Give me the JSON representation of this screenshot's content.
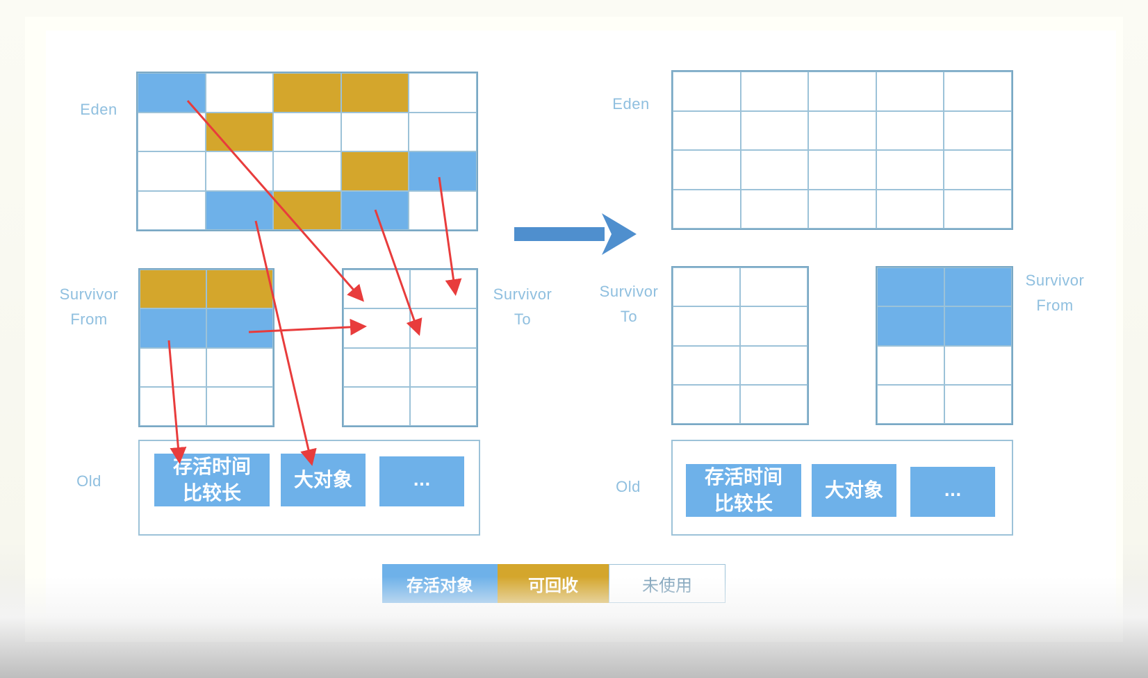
{
  "colors": {
    "live": "#6eb1e9",
    "reclaimable": "#d4a62c",
    "unused": "#ffffff",
    "arrow_red": "#e83c3c",
    "arrow_blue": "#4f8fce",
    "label": "#8fbfdf"
  },
  "before": {
    "eden_label": "Eden",
    "survivor_from_label": [
      "Survivor",
      "From"
    ],
    "survivor_to_label": [
      "Survivor",
      "To"
    ],
    "old_label": "Old",
    "eden_cells": [
      [
        "live",
        "empty",
        "recl",
        "recl",
        "empty"
      ],
      [
        "empty",
        "recl",
        "empty",
        "empty",
        "empty"
      ],
      [
        "empty",
        "empty",
        "empty",
        "recl",
        "live"
      ],
      [
        "empty",
        "live",
        "recl",
        "live",
        "empty"
      ]
    ],
    "from_cells": [
      [
        "recl",
        "recl"
      ],
      [
        "live",
        "live"
      ],
      [
        "empty",
        "empty"
      ],
      [
        "empty",
        "empty"
      ]
    ],
    "to_cells": [
      [
        "empty",
        "empty"
      ],
      [
        "empty",
        "empty"
      ],
      [
        "empty",
        "empty"
      ],
      [
        "empty",
        "empty"
      ]
    ],
    "old_items": [
      "存活时间\n比较长",
      "大对象",
      "..."
    ]
  },
  "after": {
    "eden_label": "Eden",
    "survivor_to_label": [
      "Survivor",
      "To"
    ],
    "survivor_from_label": [
      "Survivor",
      "From"
    ],
    "old_label": "Old",
    "eden_cells": [
      [
        "empty",
        "empty",
        "empty",
        "empty",
        "empty"
      ],
      [
        "empty",
        "empty",
        "empty",
        "empty",
        "empty"
      ],
      [
        "empty",
        "empty",
        "empty",
        "empty",
        "empty"
      ],
      [
        "empty",
        "empty",
        "empty",
        "empty",
        "empty"
      ]
    ],
    "to_cells": [
      [
        "empty",
        "empty"
      ],
      [
        "empty",
        "empty"
      ],
      [
        "empty",
        "empty"
      ],
      [
        "empty",
        "empty"
      ]
    ],
    "from_cells": [
      [
        "live",
        "live"
      ],
      [
        "live",
        "live"
      ],
      [
        "empty",
        "empty"
      ],
      [
        "empty",
        "empty"
      ]
    ],
    "old_items": [
      "存活时间\n比较长",
      "大对象",
      "..."
    ]
  },
  "legend": {
    "live": "存活对象",
    "reclaimable": "可回收",
    "unused": "未使用"
  }
}
